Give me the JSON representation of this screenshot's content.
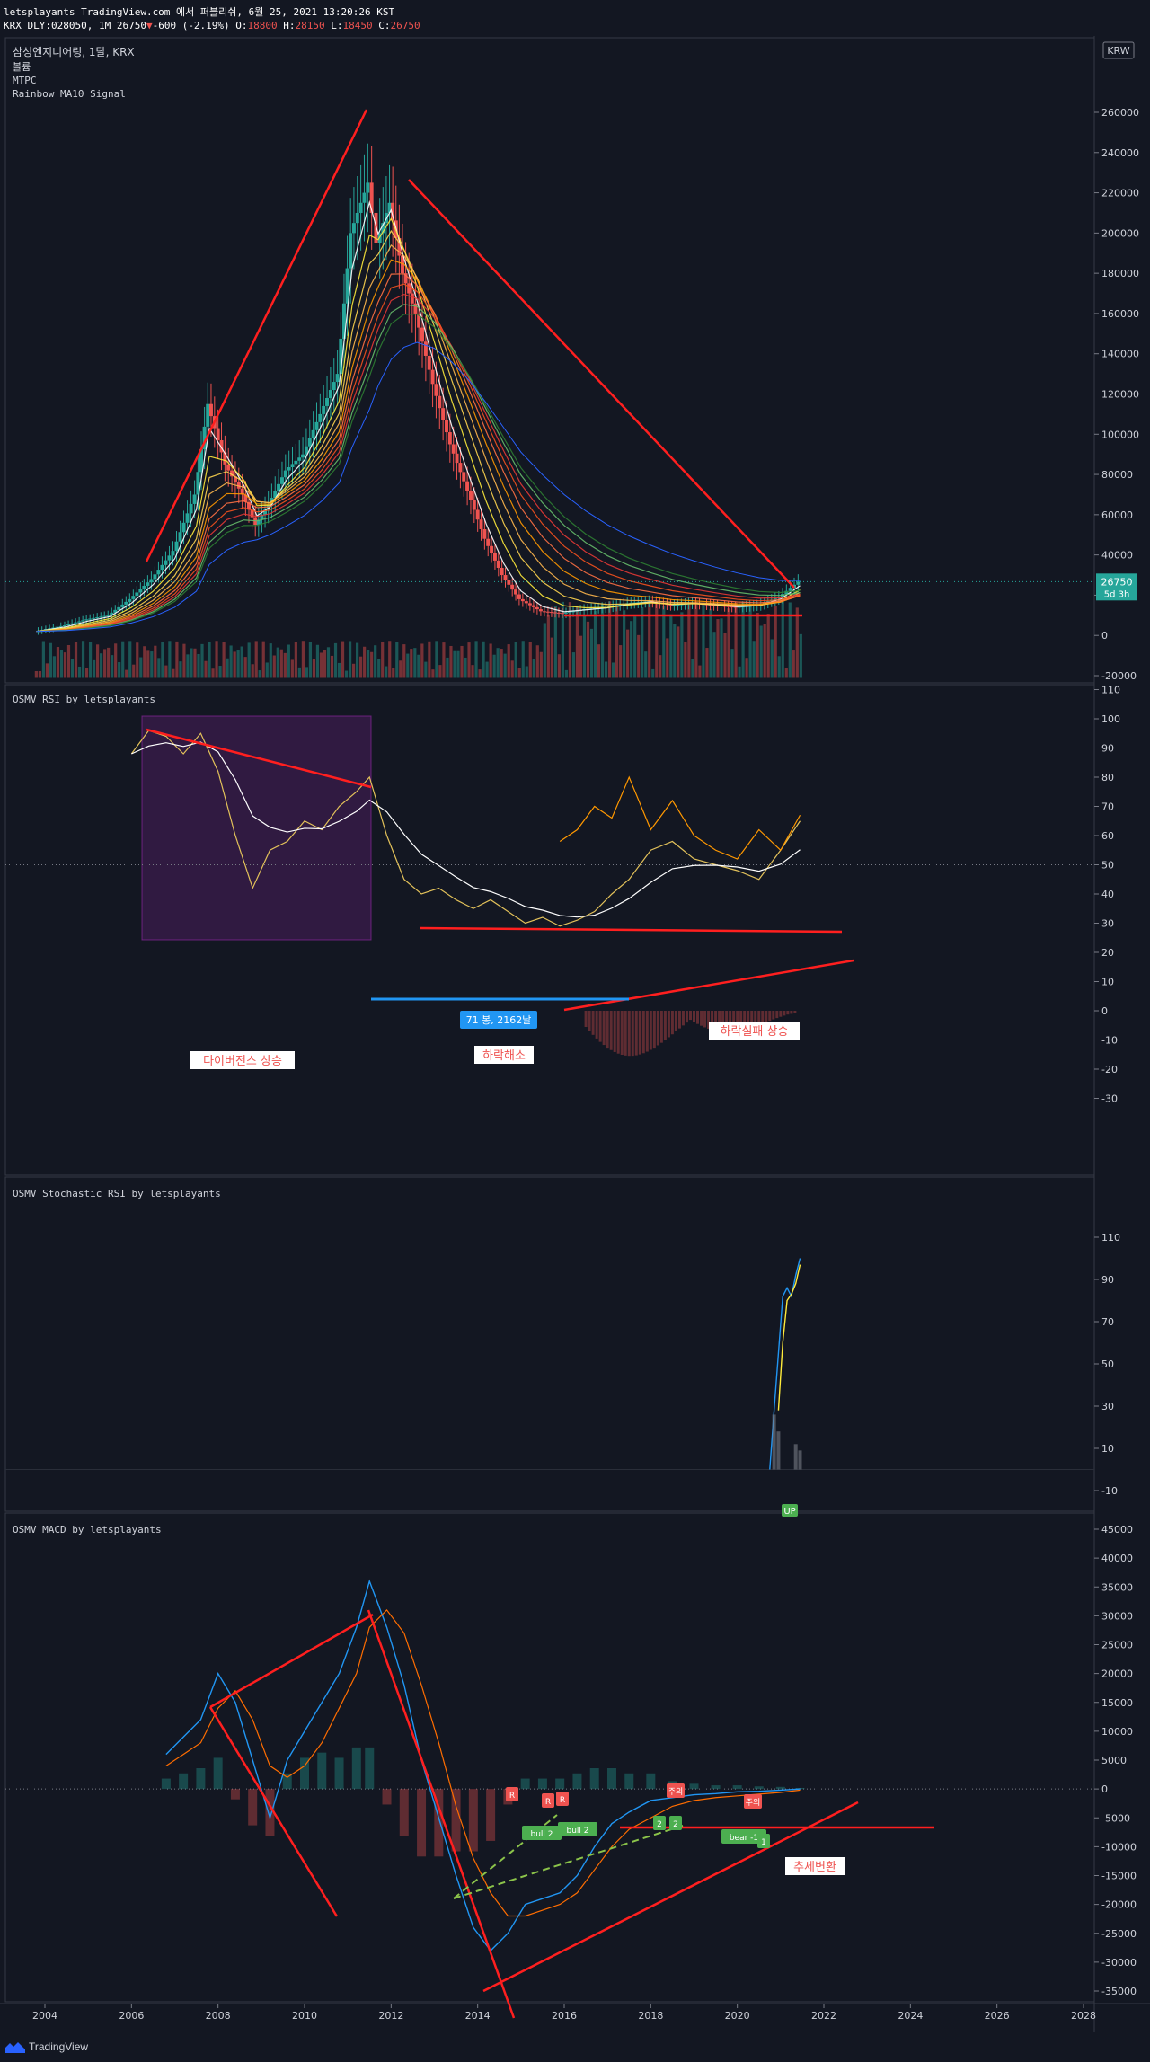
{
  "header": {
    "line1": "letsplayants TradingView.com 에서 퍼블리쉬, 6월 25, 2021 13:20:26 KST",
    "symbol": "KRX_DLY:028050, 1M 26750",
    "change_arrow": "▼",
    "change": "-600 (-2.19%)",
    "o_label": "O:",
    "o_value": "18800",
    "h_label": "H:",
    "h_value": "28150",
    "l_label": "L:",
    "l_value": "18450",
    "c_label": "C:",
    "c_value": "26750"
  },
  "main_pane": {
    "title": "삼성엔지니어링, 1달, KRX",
    "indicator_1": "볼륨",
    "indicator_2": "MTPC",
    "indicator_3": "Rainbow MA10 Signal",
    "currency": "KRW",
    "price_tag": "26750",
    "price_tag_sub": "5d 3h"
  },
  "rsi_pane": {
    "title": "OSMV RSI by letsplayants",
    "annotations": [
      "다이버전스 상승",
      "하락해소",
      "하락실패 상승"
    ],
    "bars_label": "71 봉, 2162날"
  },
  "stoch_pane": {
    "title": "OSMV Stochastic RSI by letsplayants",
    "up_label": "UP"
  },
  "macd_pane": {
    "title": "OSMV MACD by letsplayants",
    "annotation": "추세변환",
    "small_labels": [
      "R",
      "R",
      "R",
      "주의",
      "주의",
      "bull 2",
      "bull 2",
      "2",
      "2",
      "bear -1",
      "1"
    ]
  },
  "footer": {
    "brand": "TradingView"
  },
  "colors": {
    "background": "#131722",
    "grid": "#2a2e39",
    "up": "#26a69a",
    "down": "#ef5350",
    "trendline": "#ff1f1f",
    "rsi_box": "#9c27b0"
  },
  "chart_data": [
    {
      "type": "line",
      "name_hint": "price (monthly candles with rainbow moving averages)",
      "x_ticks": [
        "2004",
        "2006",
        "2008",
        "2010",
        "2012",
        "2014",
        "2016",
        "2018",
        "2020",
        "2022",
        "2024",
        "2026",
        "2028"
      ],
      "y_ticks": [
        -20000,
        0,
        20000,
        40000,
        60000,
        80000,
        100000,
        120000,
        140000,
        160000,
        180000,
        200000,
        220000,
        240000,
        260000
      ],
      "ylim": [
        -22000,
        270000
      ],
      "xlim": [
        2003.6,
        2028.1
      ],
      "x": [
        2003.8,
        2004.5,
        2005.0,
        2005.5,
        2006.0,
        2006.5,
        2007.0,
        2007.5,
        2007.8,
        2008.2,
        2008.6,
        2008.9,
        2009.2,
        2009.6,
        2010.0,
        2010.4,
        2010.8,
        2011.1,
        2011.5,
        2011.7,
        2012.0,
        2012.3,
        2012.6,
        2013.0,
        2013.4,
        2013.8,
        2014.2,
        2014.6,
        2015.0,
        2015.5,
        2016.0,
        2016.5,
        2017.0,
        2017.5,
        2018.0,
        2018.5,
        2019.0,
        2019.5,
        2020.0,
        2020.5,
        2021.0,
        2021.45
      ],
      "close": [
        2000,
        5000,
        8000,
        10000,
        18000,
        28000,
        42000,
        70000,
        115000,
        85000,
        70000,
        55000,
        65000,
        82000,
        90000,
        110000,
        130000,
        200000,
        225000,
        195000,
        215000,
        180000,
        160000,
        125000,
        95000,
        72000,
        48000,
        30000,
        18000,
        12000,
        11000,
        13000,
        14000,
        16000,
        17000,
        15000,
        16000,
        15000,
        14000,
        15000,
        19000,
        26750
      ],
      "volume_max": 48000,
      "last_price": 26750
    },
    {
      "type": "line",
      "name_hint": "rsi",
      "y_ticks": [
        -30,
        -20,
        -10,
        0,
        10,
        20,
        30,
        40,
        50,
        60,
        70,
        80,
        90,
        100,
        110
      ],
      "ylim": [
        -30,
        110
      ],
      "x": [
        2006.0,
        2006.4,
        2006.8,
        2007.2,
        2007.6,
        2008.0,
        2008.4,
        2008.8,
        2009.2,
        2009.6,
        2010.0,
        2010.4,
        2010.8,
        2011.2,
        2011.5,
        2011.9,
        2012.3,
        2012.7,
        2013.1,
        2013.5,
        2013.9,
        2014.3,
        2014.7,
        2015.1,
        2015.5,
        2015.9,
        2016.3,
        2016.7,
        2017.1,
        2017.5,
        2018.0,
        2018.5,
        2019.0,
        2019.5,
        2020.0,
        2020.5,
        2021.0,
        2021.45
      ],
      "rsi": [
        88,
        96,
        94,
        88,
        95,
        82,
        60,
        42,
        55,
        58,
        65,
        62,
        70,
        75,
        80,
        60,
        45,
        40,
        42,
        38,
        35,
        38,
        34,
        30,
        32,
        29,
        31,
        34,
        40,
        45,
        55,
        58,
        52,
        50,
        48,
        45,
        55,
        65
      ],
      "rsi_fast": [
        null,
        null,
        null,
        null,
        null,
        null,
        null,
        null,
        null,
        null,
        null,
        null,
        null,
        null,
        null,
        null,
        null,
        null,
        null,
        null,
        null,
        null,
        null,
        null,
        null,
        58,
        62,
        70,
        66,
        80,
        62,
        72,
        60,
        55,
        52,
        62,
        55,
        67
      ],
      "level_line": 50
    },
    {
      "type": "line",
      "name_hint": "stochastic rsi",
      "y_ticks": [
        -10,
        10,
        30,
        50,
        70,
        90,
        110
      ],
      "ylim": [
        -10,
        110
      ],
      "x": [
        2020.75,
        2020.85,
        2020.95,
        2021.05,
        2021.15,
        2021.25,
        2021.35,
        2021.45
      ],
      "k": [
        0,
        28,
        55,
        82,
        86,
        82,
        92,
        100
      ],
      "d": [
        null,
        null,
        28,
        60,
        80,
        83,
        88,
        97
      ]
    },
    {
      "type": "line",
      "name_hint": "macd",
      "y_ticks": [
        -35000,
        -30000,
        -25000,
        -20000,
        -15000,
        -10000,
        -5000,
        0,
        5000,
        10000,
        15000,
        20000,
        25000,
        30000,
        35000,
        40000,
        45000
      ],
      "ylim": [
        -37000,
        47000
      ],
      "x": [
        2006.8,
        2007.2,
        2007.6,
        2008.0,
        2008.4,
        2008.8,
        2009.2,
        2009.6,
        2010.0,
        2010.4,
        2010.8,
        2011.2,
        2011.5,
        2011.9,
        2012.3,
        2012.7,
        2013.1,
        2013.5,
        2013.9,
        2014.3,
        2014.7,
        2015.1,
        2015.5,
        2015.9,
        2016.3,
        2016.7,
        2017.1,
        2017.5,
        2018.0,
        2018.5,
        2019.0,
        2019.5,
        2020.0,
        2020.5,
        2021.0,
        2021.45
      ],
      "macd": [
        6000,
        9000,
        12000,
        20000,
        15000,
        5000,
        -5000,
        5000,
        10000,
        15000,
        20000,
        28000,
        36000,
        28000,
        18000,
        5000,
        -5000,
        -15000,
        -24000,
        -28000,
        -25000,
        -20000,
        -19000,
        -18000,
        -15000,
        -10000,
        -6000,
        -4000,
        -2000,
        -1500,
        -1000,
        -800,
        -500,
        -400,
        -200,
        0
      ],
      "signal": [
        4000,
        6000,
        8000,
        14000,
        17000,
        12000,
        4000,
        2000,
        4000,
        8000,
        14000,
        20000,
        28000,
        31000,
        27000,
        18000,
        8000,
        -3000,
        -12000,
        -18000,
        -22000,
        -22000,
        -21000,
        -20000,
        -18000,
        -14000,
        -10000,
        -7000,
        -5000,
        -3000,
        -2000,
        -1500,
        -1200,
        -900,
        -600,
        -200
      ]
    }
  ]
}
